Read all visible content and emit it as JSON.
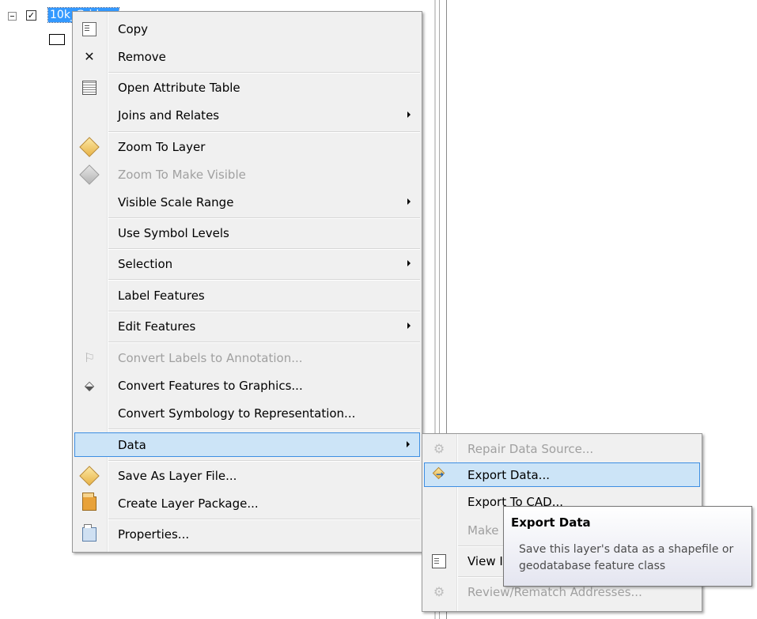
{
  "toc": {
    "layer_name": "10k_Grid",
    "checked": true,
    "check_glyph": "✓"
  },
  "context_menu": {
    "items": [
      {
        "label": "Copy",
        "icon": "copy-icon"
      },
      {
        "label": "Remove",
        "icon": "remove-x-icon"
      },
      {
        "label": "Open Attribute Table",
        "icon": "attribute-table-icon"
      },
      {
        "label": "Joins and Relates",
        "submenu": true
      },
      {
        "label": "Zoom To Layer",
        "icon": "zoom-to-layer-icon"
      },
      {
        "label": "Zoom To Make Visible",
        "icon": "zoom-to-make-visible-icon",
        "disabled": true
      },
      {
        "label": "Visible Scale Range",
        "submenu": true
      },
      {
        "label": "Use Symbol Levels"
      },
      {
        "label": "Selection",
        "submenu": true
      },
      {
        "label": "Label Features"
      },
      {
        "label": "Edit Features",
        "submenu": true
      },
      {
        "label": "Convert Labels to Annotation...",
        "icon": "convert-labels-icon",
        "disabled": true
      },
      {
        "label": "Convert Features to Graphics...",
        "icon": "convert-graphics-icon"
      },
      {
        "label": "Convert Symbology to Representation..."
      },
      {
        "label": "Data",
        "submenu": true,
        "highlighted": true
      },
      {
        "label": "Save As Layer File...",
        "icon": "layer-file-icon"
      },
      {
        "label": "Create Layer Package...",
        "icon": "layer-package-icon"
      },
      {
        "label": "Properties...",
        "icon": "properties-icon"
      }
    ]
  },
  "data_submenu": {
    "items": [
      {
        "label": "Repair Data Source...",
        "icon": "repair-data-icon",
        "disabled": true
      },
      {
        "label": "Export Data...",
        "icon": "export-data-icon",
        "highlighted": true
      },
      {
        "label": "Export To CAD..."
      },
      {
        "label": "Make Permanent"
      },
      {
        "label": "View Item Description...",
        "icon": "view-description-icon"
      },
      {
        "label": "Review/Rematch Addresses...",
        "icon": "review-addresses-icon",
        "disabled": true
      }
    ]
  },
  "tooltip": {
    "title": "Export Data",
    "body": "Save this layer's data as a shapefile or geodatabase feature class"
  },
  "colors": {
    "selection_blue": "#3399ff",
    "menu_highlight": "#cce4f7",
    "menu_highlight_border": "#3d8ee2",
    "menu_background": "#f0f0f0",
    "disabled_text": "#a0a0a0"
  }
}
